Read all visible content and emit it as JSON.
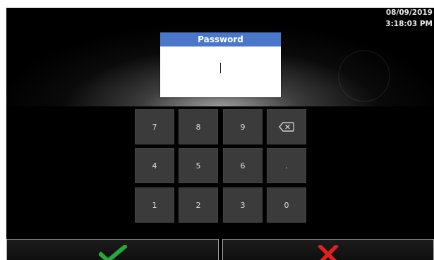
{
  "status": {
    "date": "08/09/2019",
    "time": "3:18:03 PM"
  },
  "password_dialog": {
    "title": "Password",
    "value": ""
  },
  "keypad": {
    "rows": [
      [
        "7",
        "8",
        "9",
        "backspace"
      ],
      [
        "4",
        "5",
        "6",
        "."
      ],
      [
        "1",
        "2",
        "3",
        "0"
      ]
    ],
    "labels": {
      "k7": "7",
      "k8": "8",
      "k9": "9",
      "k4": "4",
      "k5": "5",
      "k6": "6",
      "kdot": ".",
      "k1": "1",
      "k2": "2",
      "k3": "3",
      "k0": "0"
    },
    "backspace_icon": "backspace-icon"
  },
  "actions": {
    "confirm_icon": "checkmark-icon",
    "cancel_icon": "x-icon"
  },
  "colors": {
    "dialog_title_bar": "#4a77c9",
    "key_background": "#3b3b3b",
    "confirm": "#27a83a",
    "cancel": "#e02020",
    "screen_background": "#000000"
  }
}
